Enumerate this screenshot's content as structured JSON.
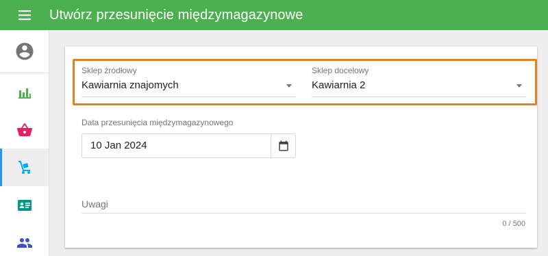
{
  "header": {
    "title": "Utwórz przesunięcie międzymagazynowe",
    "menu_icon": "hamburger-menu-icon",
    "background": "#4caf50"
  },
  "sidebar": {
    "avatar_icon": "account-circle-icon",
    "items": [
      {
        "icon": "bar-chart-icon",
        "color": "#4caf50"
      },
      {
        "icon": "shopping-basket-icon",
        "color": "#e91e63"
      },
      {
        "icon": "hand-truck-icon",
        "color": "#03a9f4",
        "active": true
      },
      {
        "icon": "contact-card-icon",
        "color": "#009688"
      },
      {
        "icon": "people-icon",
        "color": "#3f51b5"
      }
    ]
  },
  "form": {
    "source_store": {
      "label": "Sklep źródłowy",
      "value": "Kawiarnia znajomych"
    },
    "target_store": {
      "label": "Sklep docelowy",
      "value": "Kawiarnia 2"
    },
    "transfer_date": {
      "label": "Data przesunięcia międzymagazynowego",
      "value": "10 Jan 2024"
    },
    "notes": {
      "placeholder": "Uwagi",
      "counter": "0 / 500"
    }
  },
  "colors": {
    "highlight_border": "#e67e22",
    "active_indicator": "#2196f3"
  }
}
